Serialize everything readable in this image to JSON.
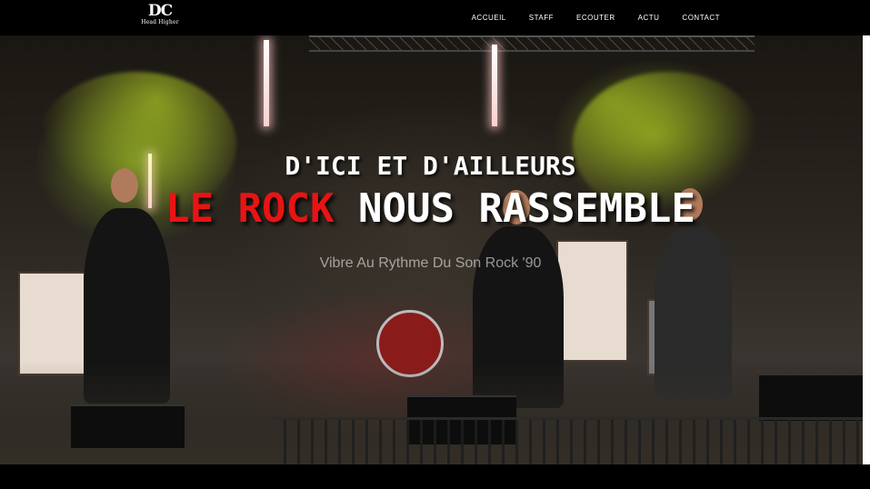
{
  "logo": {
    "main": "DC",
    "sub": "Head Higher"
  },
  "nav": [
    {
      "label": "ACCUEIL"
    },
    {
      "label": "STAFF"
    },
    {
      "label": "ECOUTER"
    },
    {
      "label": "ACTU"
    },
    {
      "label": "CONTACT"
    }
  ],
  "hero": {
    "line1": "D'ICI ET D'AILLEURS",
    "line2_red": "LE ROCK",
    "line2_white": " NOUS RASSEMBLE",
    "tagline": "Vibre Au Rythme Du Son Rock '90"
  },
  "colors": {
    "accent_red": "#e81414",
    "nav_bg": "#000000"
  }
}
